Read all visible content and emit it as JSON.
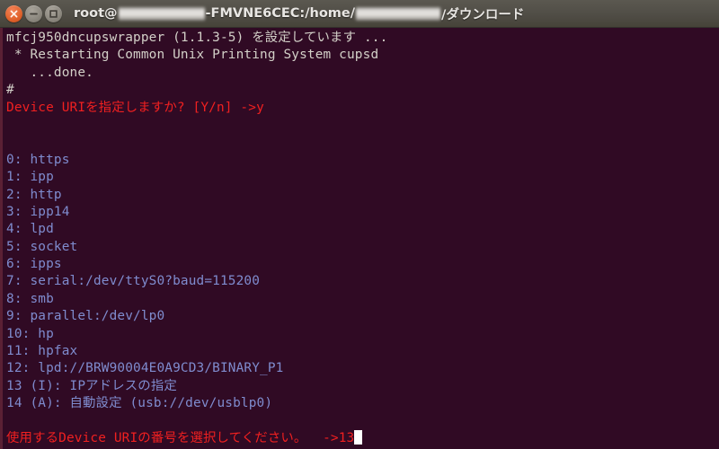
{
  "window": {
    "titlebar": {
      "buttons": [
        {
          "name": "close-button",
          "icon": "close-icon",
          "label": "×"
        },
        {
          "name": "minimize-button",
          "icon": "minimize-icon",
          "label": "−"
        },
        {
          "name": "maximize-button",
          "icon": "maximize-icon",
          "label": "□"
        }
      ],
      "title_prefix": "root@",
      "title_host_suffix": "-FMVNE6CEC: ",
      "title_path_prefix": "/home/",
      "title_path_suffix": "/ダウンロード",
      "redacted_user": "",
      "redacted_home": ""
    },
    "colors": {
      "titlebar_bg": "#514e47",
      "terminal_bg": "#300a24",
      "terminal_border": "#5a2034",
      "text_default": "#d3d0c8",
      "text_prompt_red": "#f02020",
      "text_option_blue": "#7f8ccf",
      "cursor": "#ffffff",
      "close_button": "#e2642d"
    }
  },
  "terminal": {
    "lines": [
      {
        "id": "line-pkg-config",
        "text": "mfcj950dncupswrapper (1.1.3-5) を設定しています ...",
        "color": "white"
      },
      {
        "id": "line-restart-cups",
        "text": " * Restarting Common Unix Printing System cupsd",
        "color": "white"
      },
      {
        "id": "line-done",
        "text": "   ...done.",
        "color": "white"
      },
      {
        "id": "line-shell-prompt",
        "text": "#",
        "color": "white"
      },
      {
        "id": "line-uri-question",
        "text": "Device URIを指定しますか? [Y/n] ->y",
        "color": "red"
      },
      {
        "id": "line-blank-1",
        "text": "",
        "color": "white"
      },
      {
        "id": "line-blank-2",
        "text": "",
        "color": "white"
      },
      {
        "id": "line-opt-0",
        "text": "0: https",
        "color": "blue"
      },
      {
        "id": "line-opt-1",
        "text": "1: ipp",
        "color": "blue"
      },
      {
        "id": "line-opt-2",
        "text": "2: http",
        "color": "blue"
      },
      {
        "id": "line-opt-3",
        "text": "3: ipp14",
        "color": "blue"
      },
      {
        "id": "line-opt-4",
        "text": "4: lpd",
        "color": "blue"
      },
      {
        "id": "line-opt-5",
        "text": "5: socket",
        "color": "blue"
      },
      {
        "id": "line-opt-6",
        "text": "6: ipps",
        "color": "blue"
      },
      {
        "id": "line-opt-7",
        "text": "7: serial:/dev/ttyS0?baud=115200",
        "color": "blue"
      },
      {
        "id": "line-opt-8",
        "text": "8: smb",
        "color": "blue"
      },
      {
        "id": "line-opt-9",
        "text": "9: parallel:/dev/lp0",
        "color": "blue"
      },
      {
        "id": "line-opt-10",
        "text": "10: hp",
        "color": "blue"
      },
      {
        "id": "line-opt-11",
        "text": "11: hpfax",
        "color": "blue"
      },
      {
        "id": "line-opt-12",
        "text": "12: lpd://BRW90004E0A9CD3/BINARY_P1",
        "color": "blue"
      },
      {
        "id": "line-opt-13",
        "text": "13 (I): IPアドレスの指定",
        "color": "blue"
      },
      {
        "id": "line-opt-14",
        "text": "14 (A): 自動設定 (usb://dev/usblp0)",
        "color": "blue"
      },
      {
        "id": "line-blank-3",
        "text": "",
        "color": "white"
      }
    ],
    "final_prompt": {
      "text": "使用するDevice URIの番号を選択してください。  ->13",
      "color": "red",
      "cursor_visible": true
    }
  }
}
